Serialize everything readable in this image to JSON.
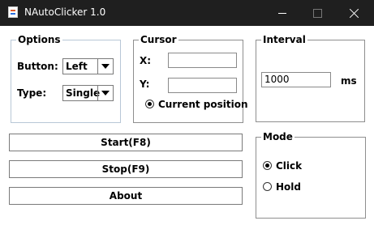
{
  "window": {
    "title": "NAutoClicker 1.0"
  },
  "options": {
    "legend": "Options",
    "button_label": "Button:",
    "button_value": "Left",
    "type_label": "Type:",
    "type_value": "Single"
  },
  "cursor": {
    "legend": "Cursor",
    "x_label": "X:",
    "x_value": "",
    "y_label": "Y:",
    "y_value": "",
    "current_position_label": "Current position",
    "current_position_selected": true
  },
  "interval": {
    "legend": "Interval",
    "value": "1000",
    "unit": "ms"
  },
  "actions": {
    "start_label": "Start(F8)",
    "stop_label": "Stop(F9)",
    "about_label": "About"
  },
  "mode": {
    "legend": "Mode",
    "options": [
      {
        "label": "Click",
        "selected": true
      },
      {
        "label": "Hold",
        "selected": false
      }
    ]
  },
  "icons": {
    "app": "app-icon",
    "minimize": "minimize-icon",
    "maximize": "maximize-icon",
    "close": "close-icon",
    "dropdown": "chevron-down-icon"
  }
}
